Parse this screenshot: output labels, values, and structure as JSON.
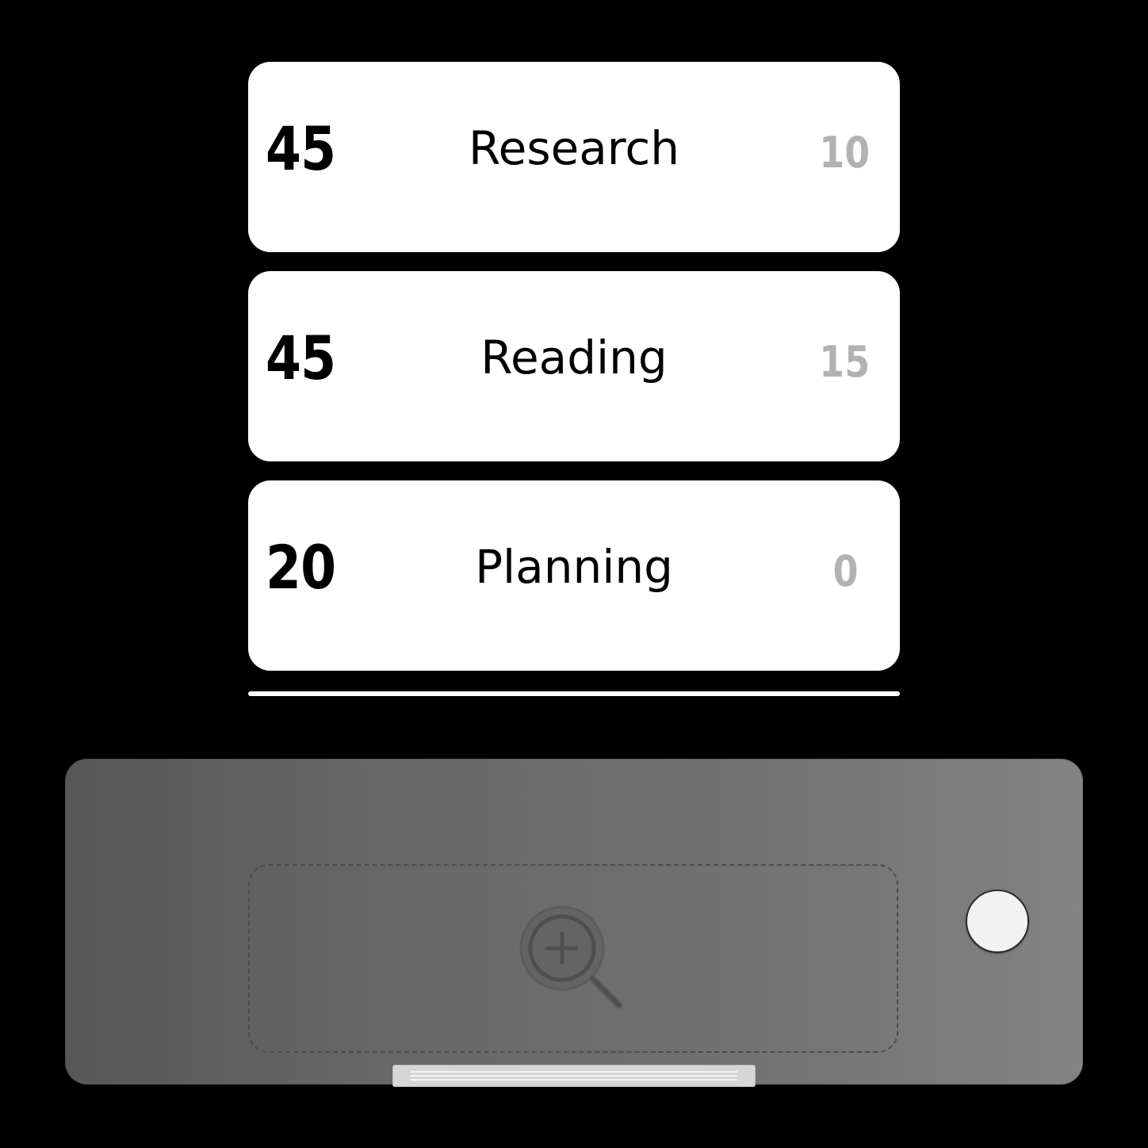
{
  "tasks": [
    {
      "left_value": "45",
      "name": "Research",
      "right_value": "10"
    },
    {
      "left_value": "45",
      "name": "Reading",
      "right_value": "15"
    },
    {
      "left_value": "20",
      "name": "Planning",
      "right_value": "0"
    }
  ],
  "tray": {
    "dropzone_icon": "zoom-in-icon",
    "button_icon": "circle-button"
  },
  "colors": {
    "background": "#000000",
    "card": "#ffffff",
    "secondary_value": "#b2b2b2",
    "tray": "#6a6a6a"
  }
}
